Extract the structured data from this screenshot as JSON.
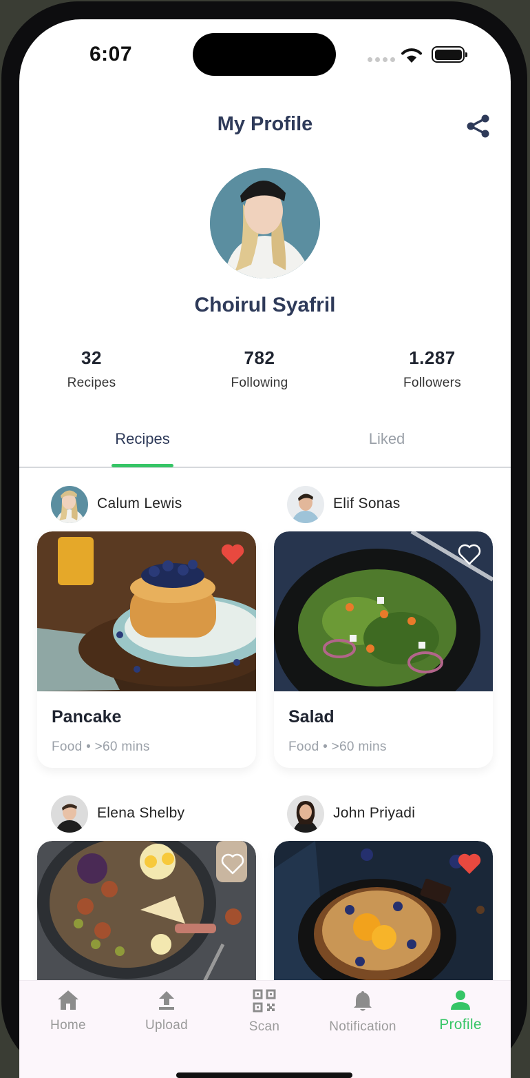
{
  "status_bar": {
    "time": "6:07"
  },
  "header": {
    "title": "My Profile",
    "share_icon": "share-icon"
  },
  "profile": {
    "name": "Choirul Syafril"
  },
  "stats": [
    {
      "value": "32",
      "label": "Recipes"
    },
    {
      "value": "782",
      "label": "Following"
    },
    {
      "value": "1.287",
      "label": "Followers"
    }
  ],
  "tabs": [
    {
      "label": "Recipes",
      "active": true
    },
    {
      "label": "Liked",
      "active": false
    }
  ],
  "recipes": [
    {
      "author": "Calum Lewis",
      "title": "Pancake",
      "category": "Food",
      "duration": ">60 mins",
      "liked": true
    },
    {
      "author": "Elif Sonas",
      "title": "Salad",
      "category": "Food",
      "duration": ">60 mins",
      "liked": false
    },
    {
      "author": "Elena Shelby",
      "title": "",
      "category": "",
      "duration": "",
      "liked": false
    },
    {
      "author": "John Priyadi",
      "title": "",
      "category": "",
      "duration": "",
      "liked": true
    }
  ],
  "meta_separator": "•",
  "bottom_nav": [
    {
      "label": "Home",
      "icon": "home-icon",
      "active": false
    },
    {
      "label": "Upload",
      "icon": "upload-icon",
      "active": false
    },
    {
      "label": "Scan",
      "icon": "qr-scan-icon",
      "active": false
    },
    {
      "label": "Notification",
      "icon": "bell-icon",
      "active": false
    },
    {
      "label": "Profile",
      "icon": "person-icon",
      "active": true
    }
  ],
  "colors": {
    "accent": "#36c566",
    "heading": "#2e3a59",
    "heart": "#e8493f",
    "muted": "#9aa0a8",
    "nav_bg": "#fcf6fb"
  }
}
